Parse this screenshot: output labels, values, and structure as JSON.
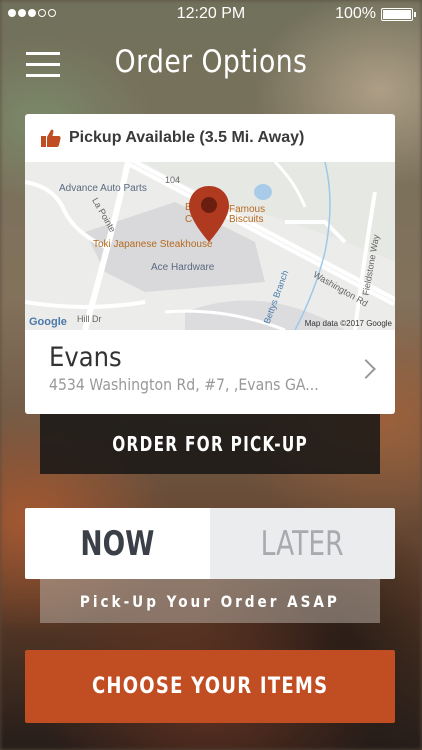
{
  "status_bar": {
    "signal_dots_filled": 3,
    "signal_dots_total": 5,
    "time": "12:20 PM",
    "battery": "100%"
  },
  "header": {
    "title": "Order Options",
    "menu_icon": "hamburger-menu-icon"
  },
  "location_card": {
    "pickup_icon": "thumbs-up-icon",
    "pickup_text": "Pickup Available (3.5 Mi. Away)",
    "map": {
      "labels": {
        "advance_auto": "Advance Auto Parts",
        "famous": "Famous",
        "biscuits": "Biscuits",
        "toki": "Toki Japanese Steakhouse",
        "ace": "Ace Hardware",
        "la_pointe": "La Pointe",
        "route_104": "104",
        "washington_rd": "Washington Rd",
        "fieldstone_way": "Fieldstone Way",
        "bettys_branch": "Bettys Branch",
        "hill_dr": "Hill Dr",
        "b_partial": "B",
        "c_partial": "C"
      },
      "google_logo": "Google",
      "credit": "Map data ©2017 Google",
      "pin_icon": "map-pin-icon"
    },
    "store_name": "Evans",
    "store_address": "4534 Washington Rd, #7, ,Evans GA...",
    "chevron_icon": "chevron-right-icon"
  },
  "order_type_button": "ORDER FOR PICK-UP",
  "time_toggle": {
    "now": "NOW",
    "later": "LATER",
    "selected": "now"
  },
  "asap_text": "Pick-Up Your Order ASAP",
  "cta_button": "CHOOSE YOUR ITEMS",
  "colors": {
    "accent": "#c04e22",
    "pin": "#b03a20",
    "thumbs_up": "#c04e22"
  }
}
